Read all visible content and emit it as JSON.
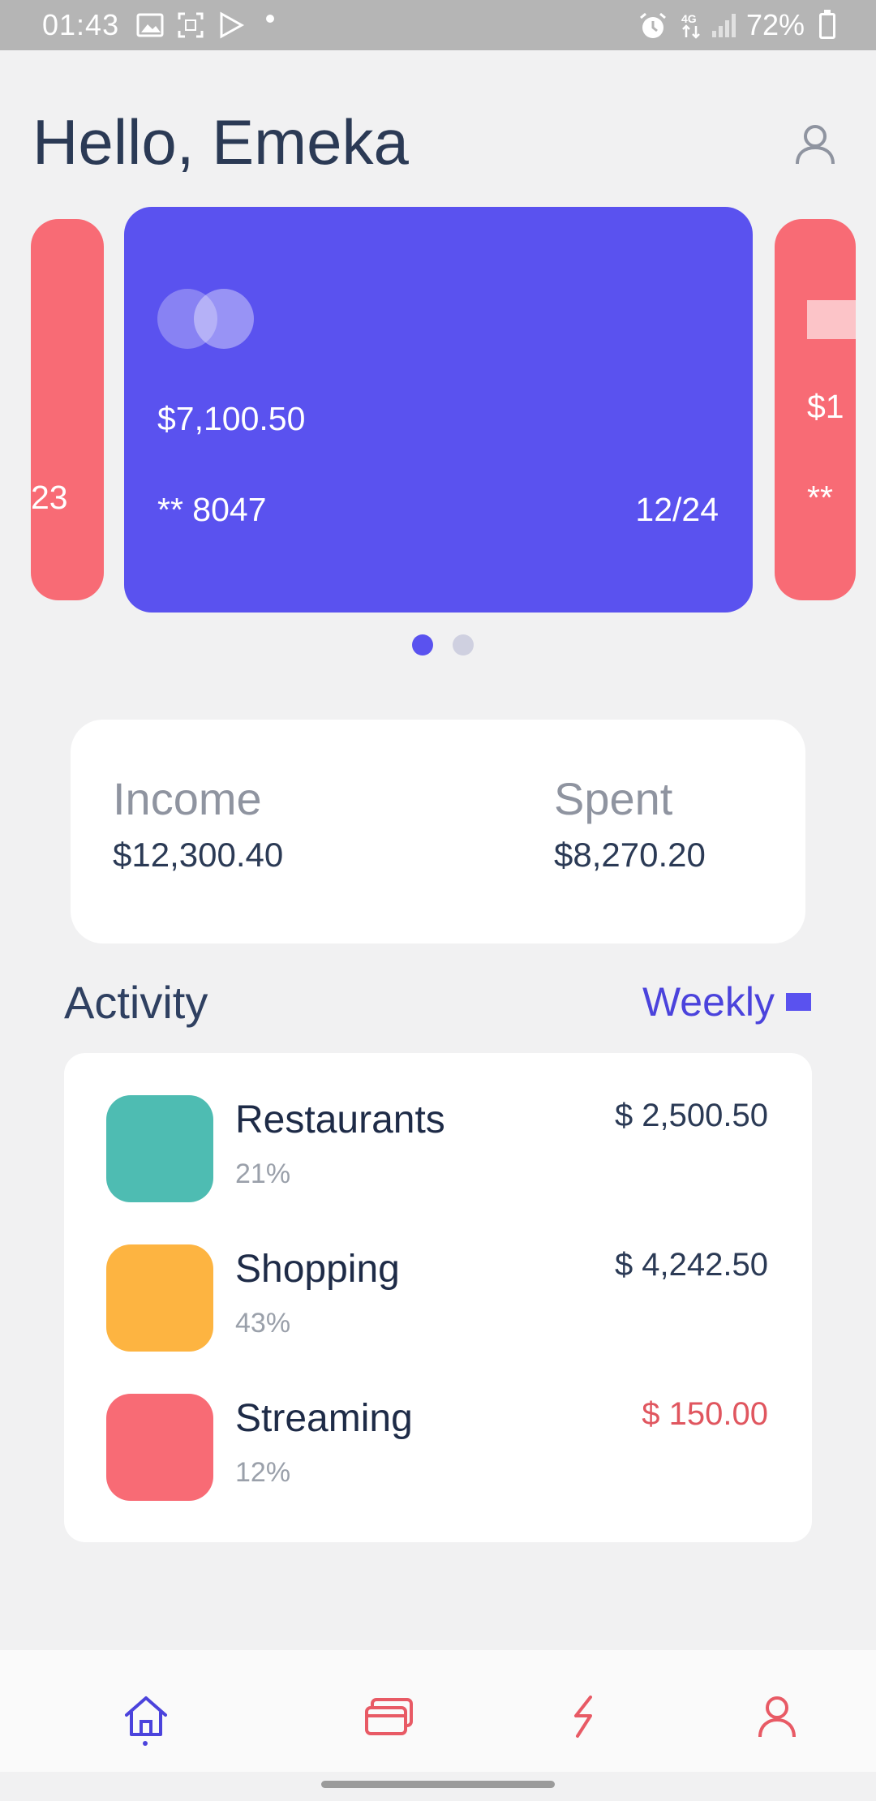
{
  "status_bar": {
    "time": "01:43",
    "battery": "72%",
    "network": "4G"
  },
  "header": {
    "greeting": "Hello, Emeka"
  },
  "cards": {
    "main": {
      "amount": "$7,100.50",
      "number": "** 8047",
      "expiry": "12/24"
    },
    "left_peek": {
      "text": "23"
    },
    "right_peek": {
      "amount": "$1",
      "number": "**"
    }
  },
  "pager": {
    "count": 2,
    "active_index": 0
  },
  "summary": {
    "income_label": "Income",
    "income_value": "$12,300.40",
    "spent_label": "Spent",
    "spent_value": "$8,270.20"
  },
  "activity": {
    "title": "Activity",
    "period": "Weekly",
    "items": [
      {
        "name": "Restaurants",
        "percent": "21%",
        "amount": "$ 2,500.50",
        "color": "#4ebcb2",
        "amount_color": "#2b3a55"
      },
      {
        "name": "Shopping",
        "percent": "43%",
        "amount": "$ 4,242.50",
        "color": "#fdb441",
        "amount_color": "#2b3a55"
      },
      {
        "name": "Streaming",
        "percent": "12%",
        "amount": "$ 150.00",
        "color": "#f86b75",
        "amount_color": "#e0565f"
      }
    ]
  },
  "colors": {
    "accent": "#5a52ef",
    "card_secondary": "#f86b75",
    "nav_active": "#4b43dc",
    "nav_inactive": "#e85a65"
  },
  "nav": {
    "items": [
      {
        "icon": "home-icon",
        "active": true
      },
      {
        "icon": "cards-icon",
        "active": false
      },
      {
        "icon": "lightning-icon",
        "active": false
      },
      {
        "icon": "profile-icon",
        "active": false
      }
    ]
  }
}
